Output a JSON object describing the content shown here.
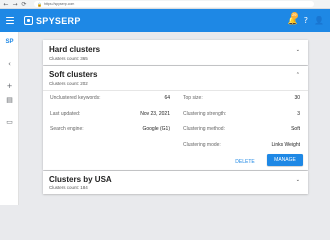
{
  "browser": {
    "url": "https://spyserp.com",
    "back_glyph": "←",
    "forward_glyph": "→",
    "reload_glyph": "⟳",
    "lock_glyph": "🔒"
  },
  "header": {
    "logo_text": "SPYSERP",
    "notification_count": "29",
    "bell_glyph": "🔔",
    "help_glyph": "?",
    "account_glyph": "👤",
    "brand_color": "#1e88e5"
  },
  "sidebar": {
    "logo_text": "SP",
    "items": [
      {
        "icon": "chevron-left-icon",
        "glyph": "‹"
      },
      {
        "icon": "plus-icon",
        "glyph": "+"
      },
      {
        "icon": "library-icon",
        "glyph": "▤"
      },
      {
        "icon": "monitor-icon",
        "glyph": "▭"
      }
    ]
  },
  "cards": {
    "hard": {
      "title": "Hard clusters",
      "subtitle": "Clusters count: 365",
      "chevron": "⌄"
    },
    "soft": {
      "title": "Soft clusters",
      "subtitle": "Clusters count: 202",
      "chevron": "⌃",
      "left_rows": [
        {
          "label": "Unclustered keywords:",
          "value": "64"
        },
        {
          "label": "Last updated:",
          "value": "Nov 23, 2021"
        },
        {
          "label": "Search engine:",
          "value": "Google (G1)"
        }
      ],
      "right_rows": [
        {
          "label": "Top size:",
          "value": "30"
        },
        {
          "label": "Clustering strength:",
          "value": "3"
        },
        {
          "label": "Clustering method:",
          "value": "Soft"
        },
        {
          "label": "Clustering mode:",
          "value": "Links Weight"
        }
      ],
      "delete_label": "DELETE",
      "manage_label": "MANAGE"
    },
    "usa": {
      "title": "Clusters by USA",
      "subtitle": "Clusters count: 184",
      "chevron": "⌄"
    }
  }
}
